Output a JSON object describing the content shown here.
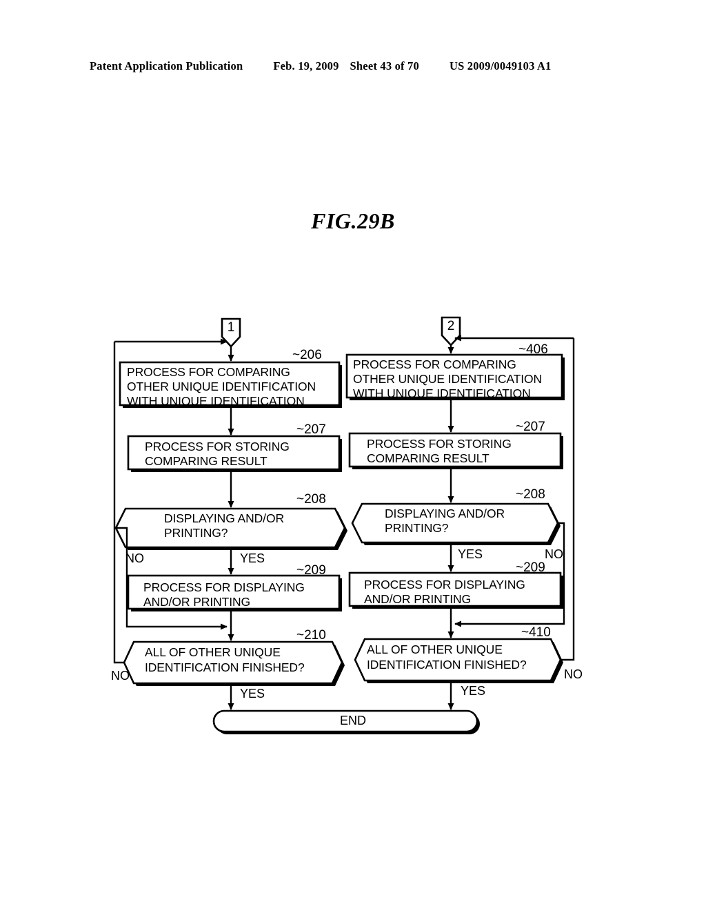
{
  "header": {
    "publication": "Patent Application Publication",
    "date": "Feb. 19, 2009",
    "sheet": "Sheet 43 of 70",
    "patent_number": "US 2009/0049103 A1"
  },
  "figure": {
    "title": "FIG.29B"
  },
  "connectors": [
    {
      "id": "connector-1",
      "label": "1"
    },
    {
      "id": "connector-2",
      "label": "2"
    }
  ],
  "left_branch": {
    "step_206": {
      "ref": "206",
      "ref_marker": "~206",
      "line1": "PROCESS FOR COMPARING",
      "line2": "OTHER UNIQUE IDENTIFICATION",
      "line3": "WITH UNIQUE IDENTIFICATION"
    },
    "step_207": {
      "ref": "207",
      "ref_marker": "~207",
      "line1": "PROCESS FOR STORING",
      "line2": "COMPARING RESULT"
    },
    "step_208": {
      "ref": "208",
      "ref_marker": "~208",
      "line1": "DISPLAYING AND/OR",
      "line2": "PRINTING?",
      "no_label": "NO",
      "yes_label": "YES"
    },
    "step_209": {
      "ref": "209",
      "ref_marker": "~209",
      "line1": "PROCESS FOR DISPLAYING",
      "line2": "AND/OR PRINTING"
    },
    "step_210": {
      "ref": "210",
      "ref_marker": "~210",
      "line1": "ALL OF OTHER UNIQUE",
      "line2": "IDENTIFICATION FINISHED?",
      "no_label": "NO",
      "yes_label": "YES"
    }
  },
  "right_branch": {
    "step_406": {
      "ref": "406",
      "ref_marker": "~406",
      "line1": "PROCESS FOR COMPARING",
      "line2": "OTHER UNIQUE IDENTIFICATION",
      "line3": "WITH UNIQUE IDENTIFICATION"
    },
    "step_207": {
      "ref": "207",
      "ref_marker": "~207",
      "line1": "PROCESS FOR STORING",
      "line2": "COMPARING RESULT"
    },
    "step_208": {
      "ref": "208",
      "ref_marker": "~208",
      "line1": "DISPLAYING AND/OR",
      "line2": "PRINTING?",
      "no_label": "NO",
      "yes_label": "YES"
    },
    "step_209": {
      "ref": "209",
      "ref_marker": "~209",
      "line1": "PROCESS FOR DISPLAYING",
      "line2": "AND/OR PRINTING"
    },
    "step_410": {
      "ref": "410",
      "ref_marker": "~410",
      "line1": "ALL OF OTHER UNIQUE",
      "line2": "IDENTIFICATION FINISHED?",
      "no_label": "NO",
      "yes_label": "YES"
    }
  },
  "terminal": {
    "end_label": "END"
  },
  "colors": {
    "ink": "#000000",
    "paper": "#ffffff"
  }
}
